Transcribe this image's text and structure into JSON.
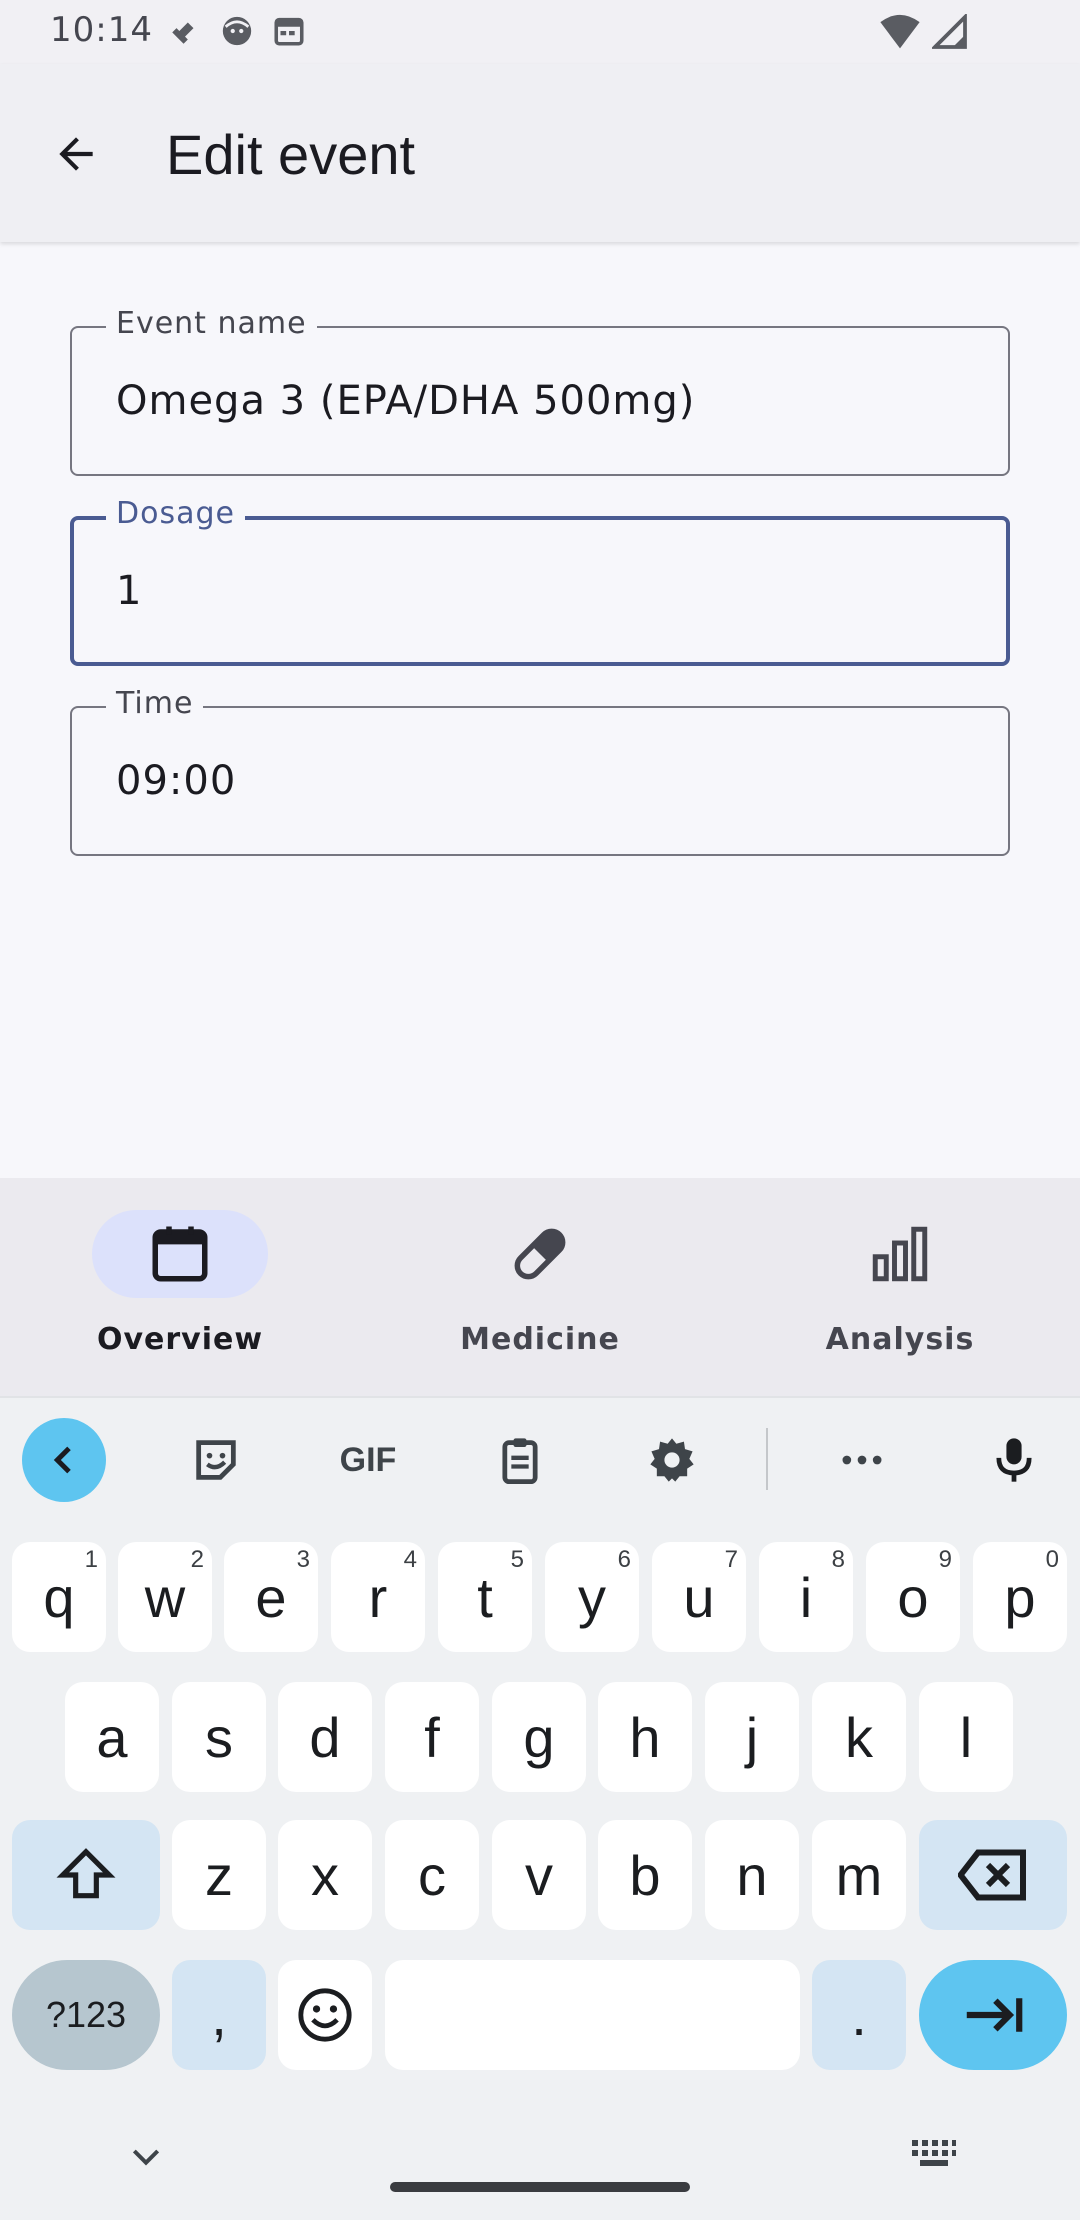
{
  "status_bar": {
    "time": "10:14",
    "left_icons": [
      "wrench-icon",
      "face-icon",
      "calendar-icon"
    ],
    "right_icons": [
      "wifi-icon",
      "signal-icon"
    ]
  },
  "app_bar": {
    "title": "Edit event",
    "back_icon": "back-arrow-icon"
  },
  "form": {
    "event_name": {
      "label": "Event name",
      "value": "Omega 3 (EPA/DHA 500mg)"
    },
    "dosage": {
      "label": "Dosage",
      "value": "1",
      "focused": true
    },
    "time": {
      "label": "Time",
      "value": "09:00"
    }
  },
  "bottom_nav": {
    "items": [
      {
        "label": "Overview",
        "icon": "calendar-icon",
        "active": true
      },
      {
        "label": "Medicine",
        "icon": "pill-icon",
        "active": false
      },
      {
        "label": "Analysis",
        "icon": "bar-chart-icon",
        "active": false
      }
    ]
  },
  "keyboard": {
    "toolbar": {
      "gif_label": "GIF",
      "icons": [
        "chevron-left-icon",
        "sticker-icon",
        "gif-icon",
        "clipboard-icon",
        "settings-icon",
        "more-icon",
        "microphone-icon"
      ]
    },
    "row1": [
      {
        "key": "q",
        "hint": "1"
      },
      {
        "key": "w",
        "hint": "2"
      },
      {
        "key": "e",
        "hint": "3"
      },
      {
        "key": "r",
        "hint": "4"
      },
      {
        "key": "t",
        "hint": "5"
      },
      {
        "key": "y",
        "hint": "6"
      },
      {
        "key": "u",
        "hint": "7"
      },
      {
        "key": "i",
        "hint": "8"
      },
      {
        "key": "o",
        "hint": "9"
      },
      {
        "key": "p",
        "hint": "0"
      }
    ],
    "row2": [
      "a",
      "s",
      "d",
      "f",
      "g",
      "h",
      "j",
      "k",
      "l"
    ],
    "row3": [
      "z",
      "x",
      "c",
      "v",
      "b",
      "n",
      "m"
    ],
    "sym_label": "?123",
    "comma": ",",
    "period": ".",
    "accent_color": "#5ec5f0",
    "modifier_color": "#d4e5f3"
  }
}
